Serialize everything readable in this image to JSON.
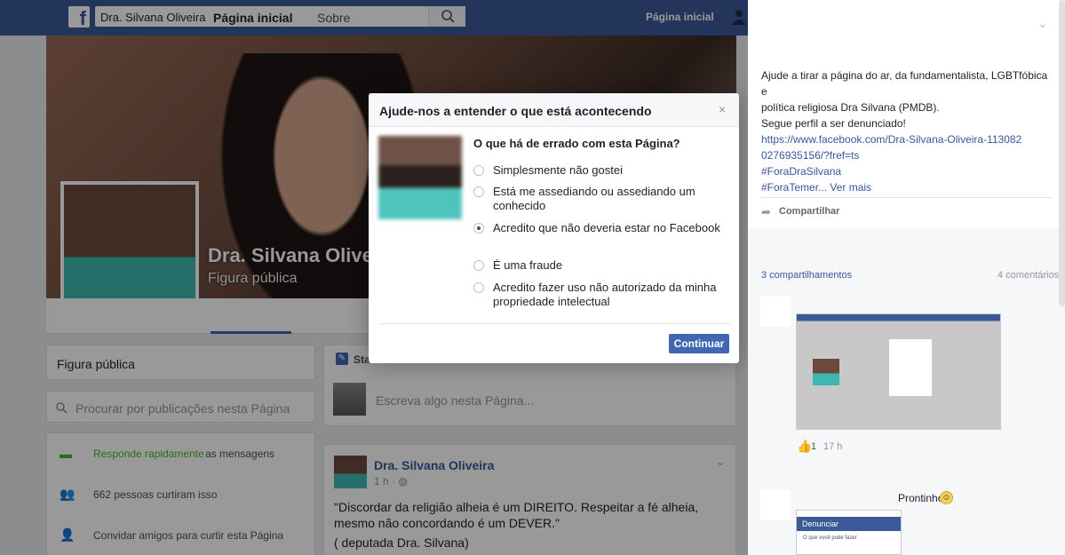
{
  "topbar": {
    "logo": "f",
    "search_value": "Dra. Silvana Oliveira",
    "home_link": "Página inicial"
  },
  "page": {
    "name": "Dra. Silvana Olive",
    "category": "Figura pública",
    "nav": {
      "home": "Página inicial",
      "about": "Sobre"
    }
  },
  "left": {
    "category_card": "Figura pública",
    "search_placeholder": "Procurar por publicações nesta Página",
    "info": {
      "responds_highlight": "Responde rapidamente",
      "responds_rest": "as mensagens",
      "likes": "662 pessoas curtiram isso",
      "invite": "Convidar amigos para curtir esta Página"
    }
  },
  "composer": {
    "head": "Sta",
    "placeholder": "Escreva algo nesta Página..."
  },
  "post": {
    "author": "Dra. Silvana Oliveira",
    "time": "1 h · ",
    "text": "\"Discordar da religião alheia é um DIREITO. Respeitar a fé alheia, mesmo não concordando é um DEVER.\"",
    "signature": "( deputada Dra. Silvana)"
  },
  "modal": {
    "title": "Ajude-nos a entender o que está acontecendo",
    "close": "×",
    "question": "O que há de errado com esta Página?",
    "options": [
      {
        "label": "Simplesmente não gostei",
        "selected": false
      },
      {
        "label": "Está me assediando ou assediando um conhecido",
        "selected": false
      },
      {
        "label": "Acredito que não deveria estar no Facebook",
        "selected": true
      },
      {
        "label": "É uma fraude",
        "selected": false
      },
      {
        "label": "Acredito fazer uso não autorizado da minha propriedade intelectual",
        "selected": false
      }
    ],
    "continue": "Continuar"
  },
  "right": {
    "text_lines": [
      "Ajude a tirar a página do ar, da fundamentalista, LGBTfóbica e",
      "política religiosa Dra Silvana (PMDB).",
      "Segue perfil a ser denunciado!"
    ],
    "link_line1": "https://www.facebook.com/Dra-Silvana-Oliveira-113082",
    "link_line2": "0276935156/?fref=ts",
    "hashtag1": "#ForaDraSilvana",
    "hashtag2": "#ForaTemer",
    "see_more": "... Ver mais",
    "share": "Compartilhar",
    "shares_count": "3 compartilhamentos",
    "comments_count": "4 comentários",
    "like_count": "1",
    "comment_time": "17 h",
    "comment2": "Prontinho.",
    "shot2_header": "Denunciar",
    "shot2_text": "O que você pode fazer"
  },
  "icons": {
    "search": "search-icon",
    "friends": "friends-icon",
    "share": "share-icon",
    "like": "like-icon"
  },
  "colors": {
    "facebook_blue": "#3b5998",
    "button_blue": "#4267b2",
    "link_blue": "#365899",
    "responds_green": "#42b72a"
  }
}
